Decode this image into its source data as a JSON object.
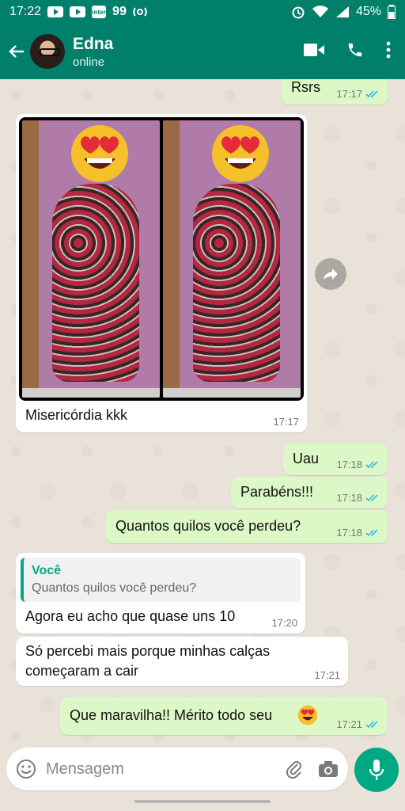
{
  "status_bar": {
    "time": "17:22",
    "battery": "45%",
    "app_badge": "inter",
    "app_badge2": "99"
  },
  "header": {
    "contact_name": "Edna",
    "contact_status": "online"
  },
  "messages": [
    {
      "text": "Rsrs",
      "time": "17:17",
      "direction": "outgoing"
    },
    {
      "text": "Misericórdia kkk",
      "time": "17:17",
      "direction": "incoming",
      "has_image": true
    },
    {
      "text": "Uau",
      "time": "17:18",
      "direction": "outgoing"
    },
    {
      "text": "Parabéns!!!",
      "time": "17:18",
      "direction": "outgoing"
    },
    {
      "text": "Quantos quilos você perdeu?",
      "time": "17:18",
      "direction": "outgoing"
    },
    {
      "text": "Agora eu acho que quase uns 10",
      "time": "17:20",
      "direction": "incoming",
      "quote_author": "Você",
      "quote_text": "Quantos quilos você perdeu?"
    },
    {
      "text_line1": "Só percebi mais porque minhas calças",
      "text_line2": "começaram a cair",
      "time": "17:21",
      "direction": "incoming"
    },
    {
      "text": "Que maravilha!! Mérito todo seu",
      "time": "17:21",
      "direction": "outgoing",
      "emoji": "heart-eyes"
    }
  ],
  "composer": {
    "placeholder": "Mensagem"
  },
  "colors": {
    "header": "#00806b",
    "outgoing_bubble": "#dcf8c6",
    "incoming_bubble": "#ffffff",
    "accent": "#00a884",
    "read_ticks": "#34b7f1"
  }
}
